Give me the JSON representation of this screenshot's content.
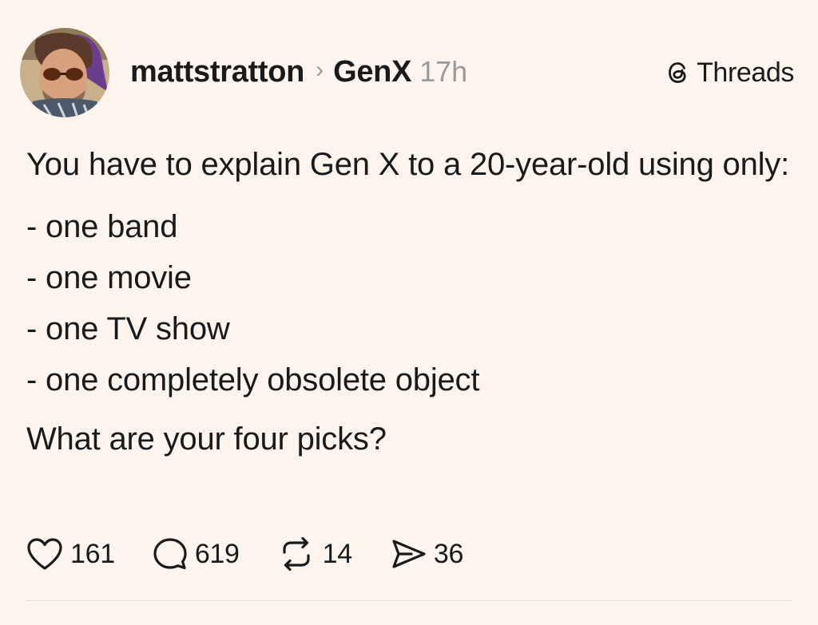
{
  "post": {
    "username": "mattstratton",
    "separator": "›",
    "community": "GenX",
    "time": "17h",
    "brand_label": "Threads",
    "intro": "You have to explain Gen X to a 20-year-old using only:",
    "list": [
      "- one band",
      "- one movie",
      "- one TV show",
      "- one completely obsolete object"
    ],
    "question": "What are your four picks?",
    "actions": {
      "likes": "161",
      "replies": "619",
      "reposts": "14",
      "shares": "36"
    }
  },
  "icons": {
    "avatar": "avatar",
    "brand": "threads-logo-icon",
    "like": "heart-icon",
    "reply": "speech-bubble-icon",
    "repost": "repost-icon",
    "share": "send-icon"
  },
  "colors": {
    "background": "#fdf5ed",
    "text": "#1a1a1a",
    "muted": "#9a9a9a"
  }
}
